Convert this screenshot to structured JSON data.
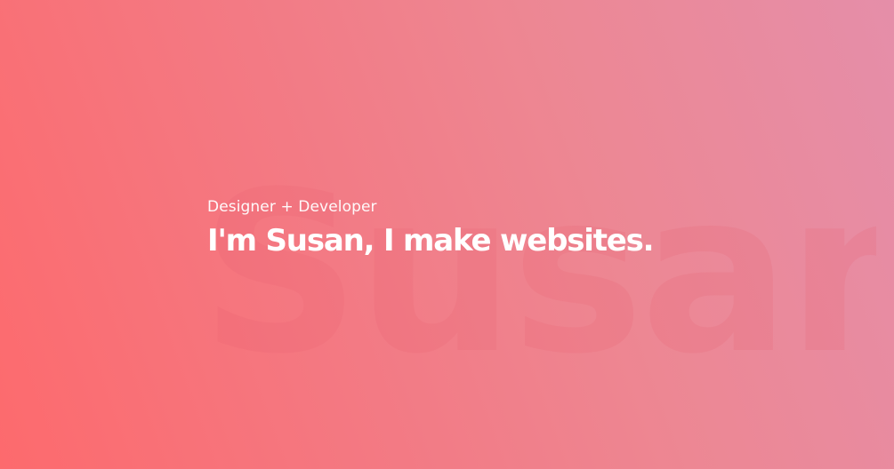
{
  "hero": {
    "background_word": "Susan",
    "tagline": "Designer + Developer",
    "headline": "I'm Susan, I make websites."
  },
  "colors": {
    "gradient_start": "#fd6a6d",
    "gradient_end": "#e58ea9",
    "text": "#ffffff"
  }
}
